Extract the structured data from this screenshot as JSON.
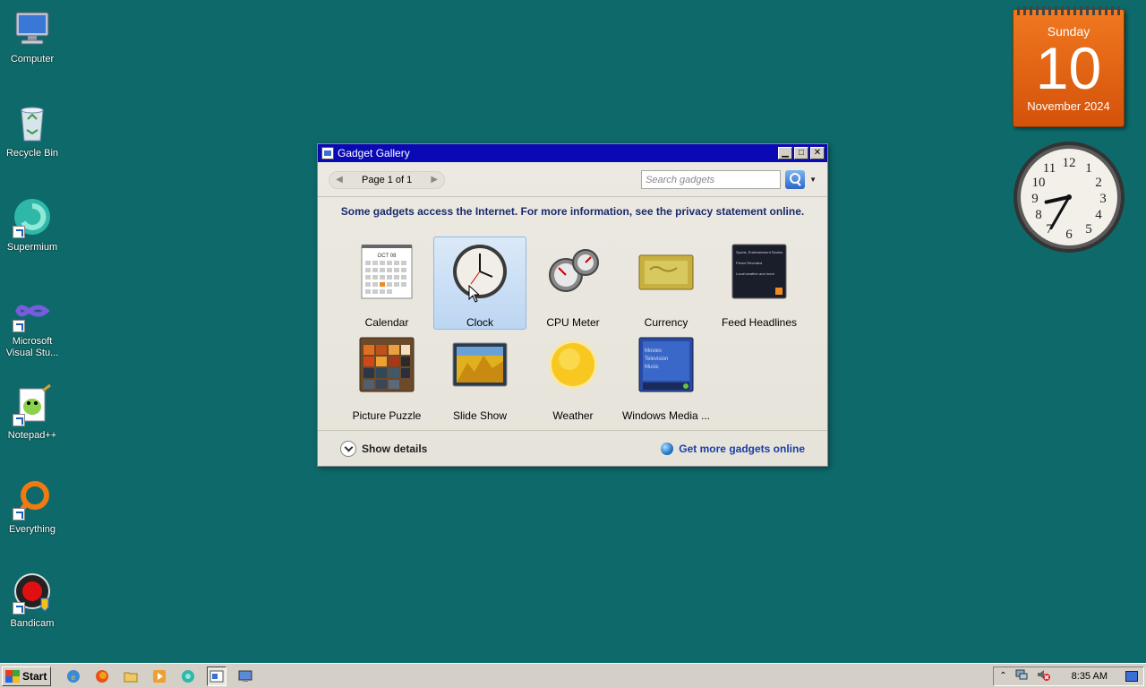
{
  "desktop": {
    "icons": [
      {
        "label": "Computer"
      },
      {
        "label": "Recycle Bin"
      },
      {
        "label": "Supermium"
      },
      {
        "label": "Microsoft Visual Stu..."
      },
      {
        "label": "Notepad++"
      },
      {
        "label": "Everything"
      },
      {
        "label": "Bandicam"
      }
    ],
    "background_color": "#0e6a6a"
  },
  "calendar_gadget": {
    "weekday": "Sunday",
    "day": "10",
    "month_year": "November 2024",
    "color": "#e8681a"
  },
  "clock_gadget": {
    "hour": 8,
    "minute": 35
  },
  "window": {
    "title": "Gadget Gallery",
    "pager_text": "Page 1 of 1",
    "search_placeholder": "Search gadgets",
    "notice": "Some gadgets access the Internet.  For more information, see the privacy statement online.",
    "gadgets": [
      {
        "label": "Calendar",
        "icon": "calendar-icon",
        "selected": false
      },
      {
        "label": "Clock",
        "icon": "clock-icon",
        "selected": true
      },
      {
        "label": "CPU Meter",
        "icon": "cpu-meter-icon",
        "selected": false
      },
      {
        "label": "Currency",
        "icon": "currency-icon",
        "selected": false
      },
      {
        "label": "Feed Headlines",
        "icon": "feed-headlines-icon",
        "selected": false
      },
      {
        "label": "Picture Puzzle",
        "icon": "picture-puzzle-icon",
        "selected": false
      },
      {
        "label": "Slide Show",
        "icon": "slide-show-icon",
        "selected": false
      },
      {
        "label": "Weather",
        "icon": "weather-icon",
        "selected": false
      },
      {
        "label": "Windows Media ...",
        "icon": "windows-media-icon",
        "selected": false
      }
    ],
    "show_details": "Show details",
    "get_more": "Get more gadgets online",
    "calendar_thumb_month": "OCT 08",
    "feed_thumb_lines": [
      "Sports, Entertainment Stories",
      "Prices Revealed",
      "Local weather and more"
    ],
    "media_thumb_lines": [
      "Movies",
      "Television",
      "Music"
    ]
  },
  "taskbar": {
    "start_label": "Start",
    "time": "8:35 AM"
  }
}
